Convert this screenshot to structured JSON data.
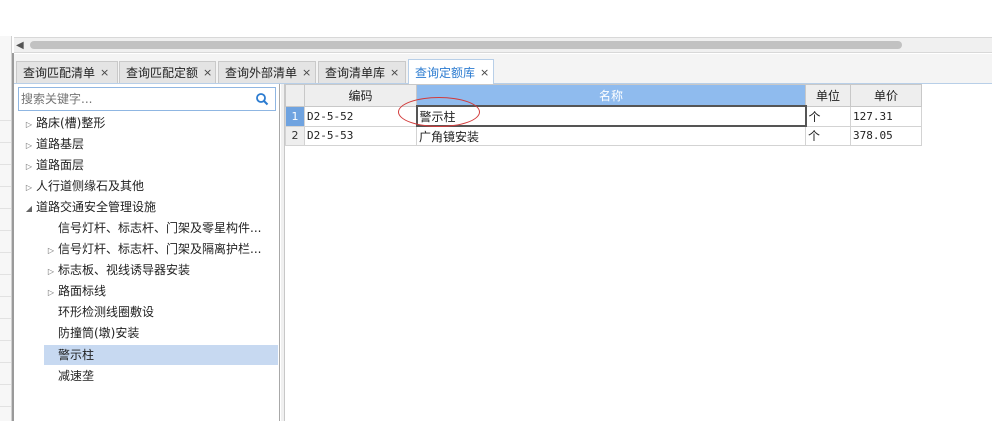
{
  "tabs": [
    {
      "label": "查询匹配清单",
      "active": false
    },
    {
      "label": "查询匹配定额",
      "active": false
    },
    {
      "label": "查询外部清单",
      "active": false
    },
    {
      "label": "查询清单库",
      "active": false
    },
    {
      "label": "查询定额库",
      "active": true
    }
  ],
  "search": {
    "placeholder": "搜索关键字..."
  },
  "tree": [
    {
      "label": "路床(槽)整形",
      "toggle": "▷"
    },
    {
      "label": "道路基层",
      "toggle": "▷"
    },
    {
      "label": "道路面层",
      "toggle": "▷"
    },
    {
      "label": "人行道侧缘石及其他",
      "toggle": "▷"
    },
    {
      "label": "道路交通安全管理设施",
      "toggle": "◢"
    },
    {
      "label": "信号灯杆、标志杆、门架及零星构件...",
      "toggle": ""
    },
    {
      "label": "信号灯杆、标志杆、门架及隔离护栏...",
      "toggle": "▷"
    },
    {
      "label": "标志板、视线诱导器安装",
      "toggle": "▷"
    },
    {
      "label": "路面标线",
      "toggle": "▷"
    },
    {
      "label": "环形检测线圈敷设",
      "toggle": ""
    },
    {
      "label": "防撞筒(墩)安装",
      "toggle": ""
    },
    {
      "label": "警示柱",
      "toggle": "",
      "selected": true
    },
    {
      "label": "减速垄",
      "toggle": ""
    }
  ],
  "grid": {
    "headers": [
      "编码",
      "名称",
      "单位",
      "单价"
    ],
    "rows": [
      {
        "num": "1",
        "code": "D2-5-52",
        "name": "警示柱",
        "unit": "个",
        "price": "127.31"
      },
      {
        "num": "2",
        "code": "D2-5-53",
        "name": "广角镜安装",
        "unit": "个",
        "price": "378.05"
      }
    ]
  },
  "icons": {
    "close": "×",
    "search": "search-icon",
    "scroll_left": "◀"
  },
  "colors": {
    "accent": "#2b7bd0",
    "header_highlight": "#8fbbee",
    "selected_row": "#c7d9f1",
    "annotation": "#d23b3b"
  }
}
